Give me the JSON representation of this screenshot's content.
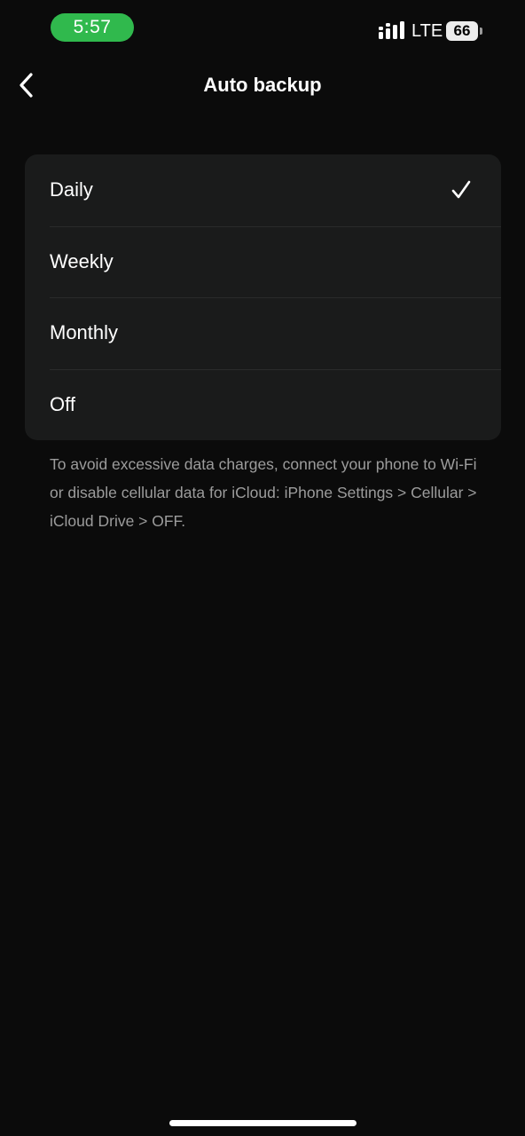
{
  "status_bar": {
    "time": "5:57",
    "time_pill_color": "#30b94d",
    "network": "LTE",
    "battery": "66",
    "signal_icon": "cellular-signal-icon"
  },
  "nav": {
    "back_icon": "chevron-left-icon",
    "title": "Auto backup"
  },
  "options": {
    "items": [
      {
        "label": "Daily",
        "selected": true
      },
      {
        "label": "Weekly",
        "selected": false
      },
      {
        "label": "Monthly",
        "selected": false
      },
      {
        "label": "Off",
        "selected": false
      }
    ],
    "selected_icon": "checkmark-icon"
  },
  "footnote": "To avoid excessive data charges, connect your phone to Wi-Fi or disable cellular data for iCloud: iPhone Settings > Cellular > iCloud Drive > OFF."
}
